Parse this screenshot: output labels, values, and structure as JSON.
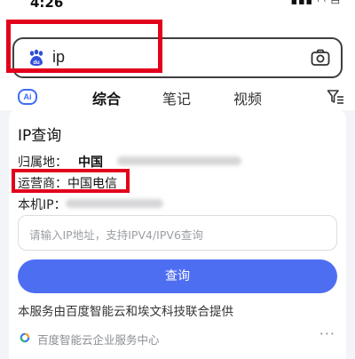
{
  "status_bar": {
    "time": "4:26",
    "icons": "▪▪▪ ◠ ▭"
  },
  "search": {
    "query": "ip"
  },
  "tabs": [
    {
      "label": "综合"
    },
    {
      "label": "笔记"
    },
    {
      "label": "视频"
    }
  ],
  "card": {
    "title": "IP查询",
    "location_label": "归属地：",
    "location_value": "中国",
    "isp_label": "运营商：",
    "isp_value": "中国电信",
    "local_ip_label": "本机IP：",
    "input_placeholder": "请输入IP地址，支持IPV4/IPV6查询",
    "query_button": "查询",
    "service_note": "本服务由百度智能云和埃文科技联合提供",
    "footer_source": "百度智能云企业服务中心"
  },
  "colors": {
    "accent": "#4e6ef2",
    "highlight_box": "#e2001a"
  }
}
